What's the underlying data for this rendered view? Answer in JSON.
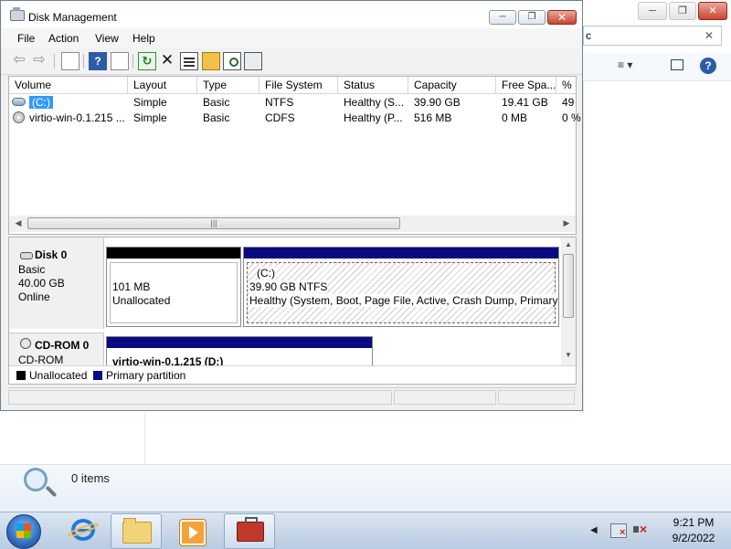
{
  "explorer": {
    "address_text": "c",
    "status_text": "0 items",
    "min_icon": "minimize-icon",
    "max_icon": "maximize-icon",
    "close_icon": "close-icon",
    "clear_label": "✕",
    "views_label": "≡ ▾",
    "help_label": "?"
  },
  "window": {
    "title": "Disk Management",
    "menu": [
      "File",
      "Action",
      "View",
      "Help"
    ],
    "toolbar": [
      "back",
      "forward",
      "up",
      "help",
      "console",
      "refresh",
      "delete",
      "properties",
      "open",
      "search",
      "settings"
    ]
  },
  "volumes": {
    "columns": [
      "Volume",
      "Layout",
      "Type",
      "File System",
      "Status",
      "Capacity",
      "Free Spa...",
      "% F"
    ],
    "rows": [
      [
        "(C:)",
        "Simple",
        "Basic",
        "NTFS",
        "Healthy (S...",
        "39.90 GB",
        "19.41 GB",
        "49"
      ],
      [
        "virtio-win-0.1.215 ...",
        "Simple",
        "Basic",
        "CDFS",
        "Healthy (P...",
        "516 MB",
        "0 MB",
        "0 %"
      ]
    ],
    "selected_row": 0
  },
  "disks": [
    {
      "name": "Disk 0",
      "type": "Basic",
      "size": "40.00 GB",
      "state": "Online",
      "partitions": [
        {
          "size": "101 MB",
          "desc": "Unallocated"
        },
        {
          "label": "(C:)",
          "size": "39.90 GB NTFS",
          "desc": "Healthy (System, Boot, Page File, Active, Crash Dump, Primary"
        }
      ]
    },
    {
      "name": "CD-ROM 0",
      "type": "CD-ROM",
      "partitions": [
        {
          "label": "virtio-win-0.1.215  (D:)"
        }
      ]
    }
  ],
  "legend": [
    {
      "label": "Unallocated",
      "color": "#000000"
    },
    {
      "label": "Primary partition",
      "color": "#0a0a80"
    }
  ],
  "taskbar": {
    "time": "9:21 PM",
    "date": "9/2/2022"
  },
  "colors": {
    "selection": "#3399ff",
    "primary_partition": "#0a0a80",
    "unallocated": "#000000"
  }
}
